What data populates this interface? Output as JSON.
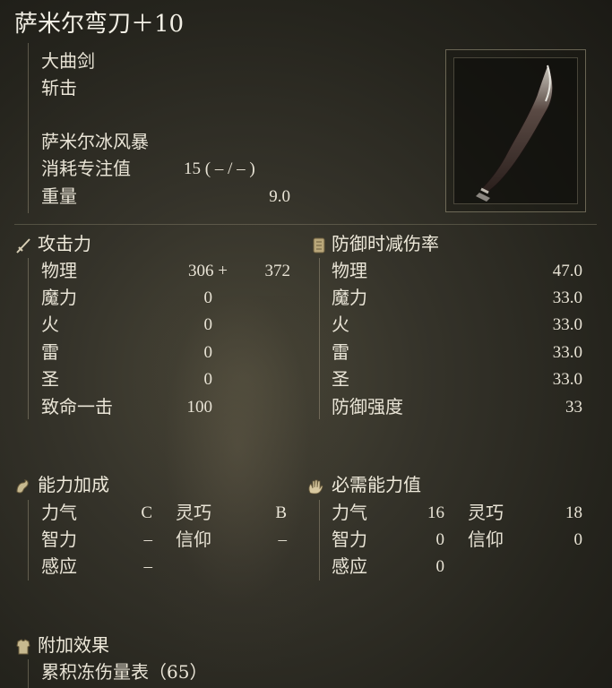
{
  "weapon": {
    "name": "萨米尔弯刀＋10",
    "type": "大曲剑",
    "attack_type": "斩击",
    "skill": "萨米尔冰风暴",
    "fp_label": "消耗专注值",
    "fp_value": "15 (    – /    – )",
    "weight_label": "重量",
    "weight_value": "9.0"
  },
  "attack": {
    "header": "攻击力",
    "rows": [
      {
        "label": "物理",
        "base": "306 +",
        "bonus": "372"
      },
      {
        "label": "魔力",
        "base": "0"
      },
      {
        "label": "火",
        "base": "0"
      },
      {
        "label": "雷",
        "base": "0"
      },
      {
        "label": "圣",
        "base": "0"
      },
      {
        "label": "致命一击",
        "base": "100"
      }
    ]
  },
  "guard": {
    "header": "防御时减伤率",
    "rows": [
      {
        "label": "物理",
        "value": "47.0"
      },
      {
        "label": "魔力",
        "value": "33.0"
      },
      {
        "label": "火",
        "value": "33.0"
      },
      {
        "label": "雷",
        "value": "33.0"
      },
      {
        "label": "圣",
        "value": "33.0"
      },
      {
        "label": "防御强度",
        "value": "33"
      }
    ]
  },
  "scaling": {
    "header": "能力加成",
    "str_label": "力气",
    "str_value": "C",
    "dex_label": "灵巧",
    "dex_value": "B",
    "int_label": "智力",
    "int_value": "–",
    "fai_label": "信仰",
    "fai_value": "–",
    "arc_label": "感应",
    "arc_value": "–"
  },
  "requirements": {
    "header": "必需能力值",
    "str_label": "力气",
    "str_value": "16",
    "dex_label": "灵巧",
    "dex_value": "18",
    "int_label": "智力",
    "int_value": "0",
    "fai_label": "信仰",
    "fai_value": "0",
    "arc_label": "感应",
    "arc_value": "0"
  },
  "effects": {
    "header": "附加效果",
    "line": "累积冻伤量表（65）"
  },
  "icons": {
    "attack": "sword-icon",
    "guard": "shield-icon",
    "scaling": "flexed-arm-icon",
    "requirements": "hand-icon",
    "effects": "armor-icon"
  }
}
